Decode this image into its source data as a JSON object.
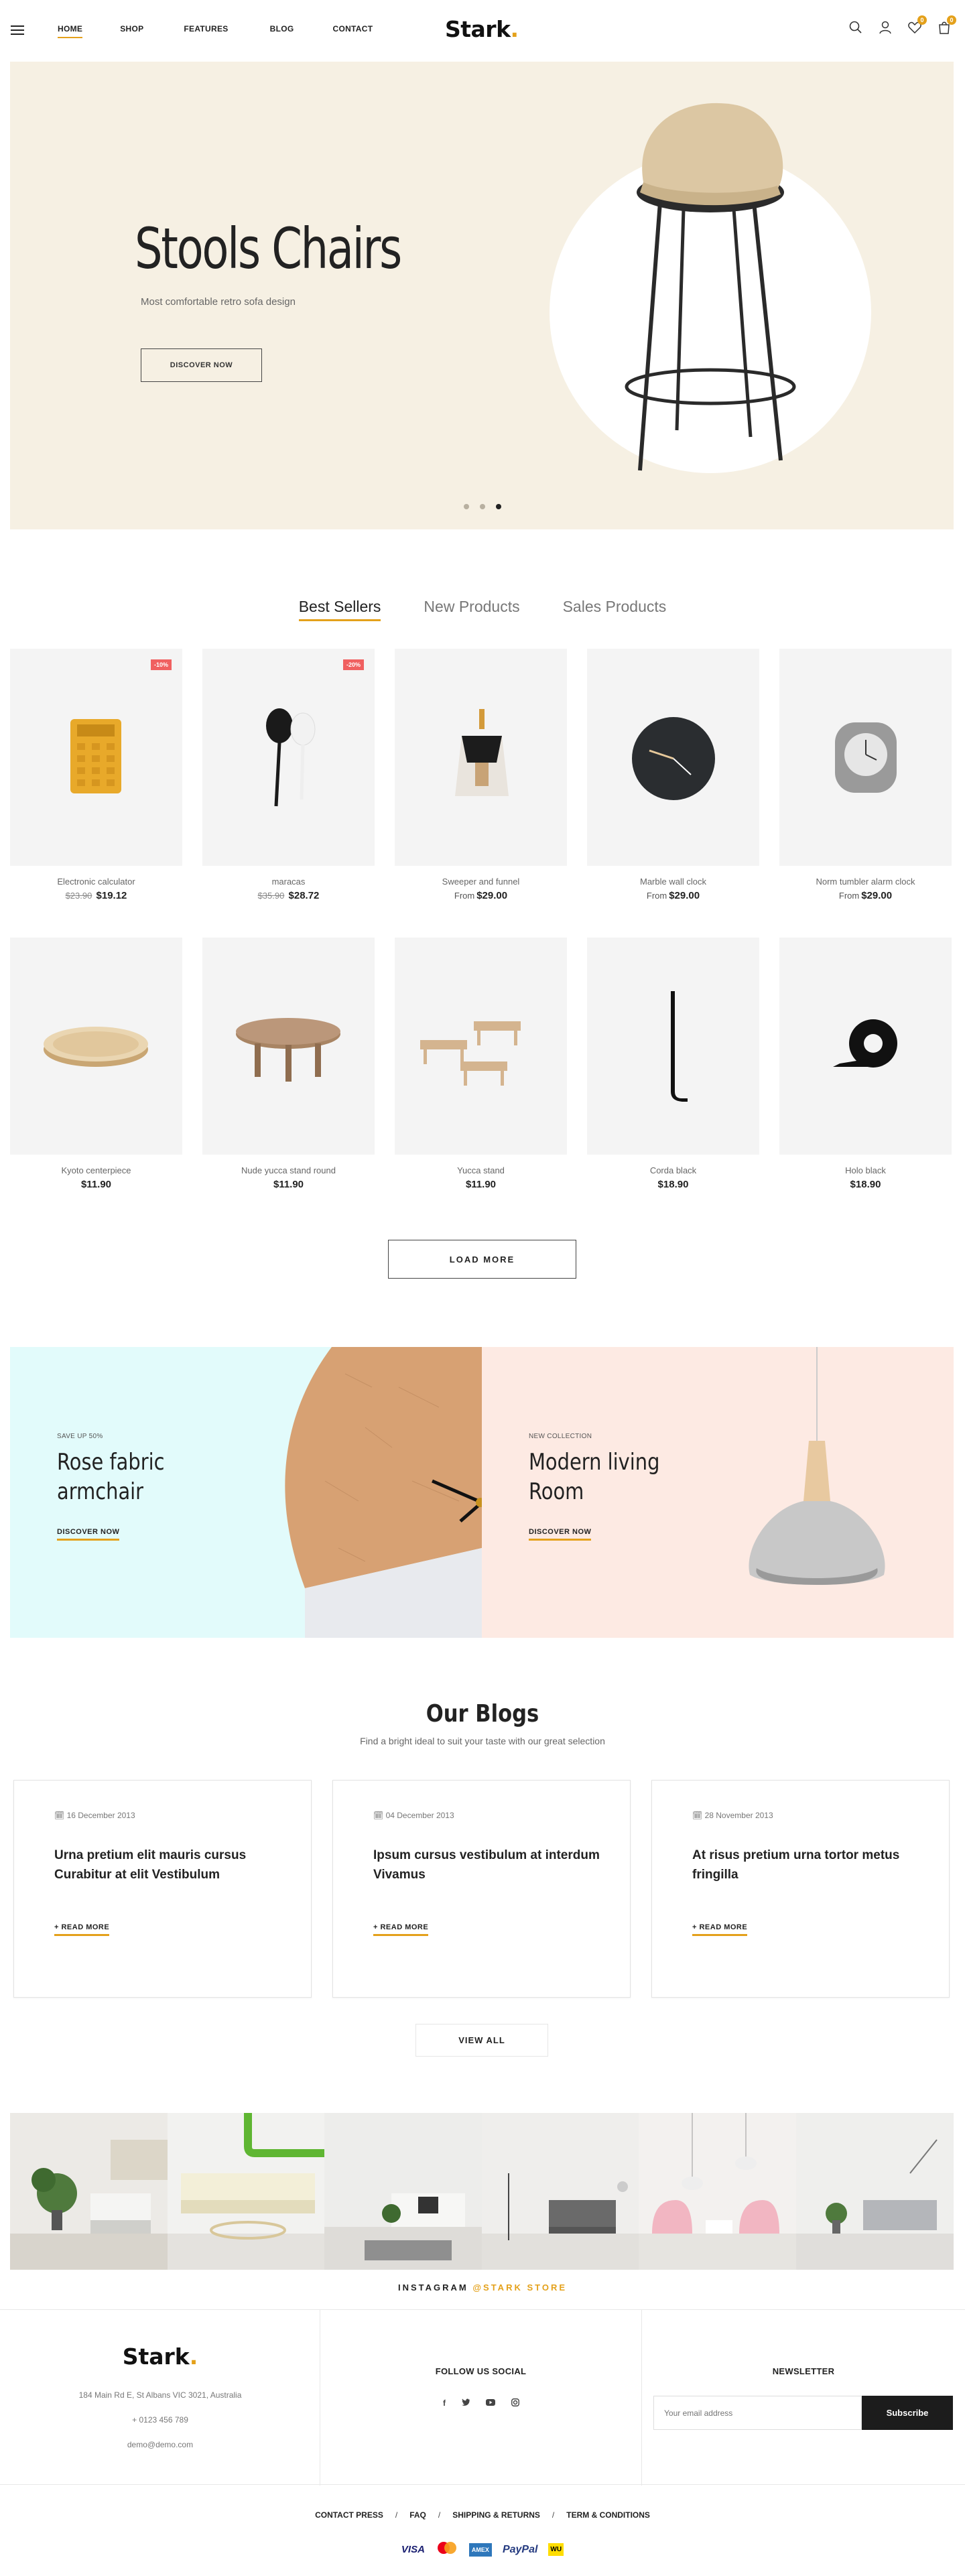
{
  "header": {
    "nav": [
      "HOME",
      "SHOP",
      "FEATURES",
      "BLOG",
      "CONTACT"
    ],
    "logo": "Stark",
    "logo_dot": ".",
    "wishlist_count": "0",
    "cart_count": "0",
    "icons": [
      "menu-icon",
      "search-icon",
      "user-icon",
      "heart-icon",
      "bag-icon"
    ]
  },
  "hero": {
    "title": "Stools Chairs",
    "subtitle": "Most comfortable retro sofa design",
    "button": "DISCOVER NOW",
    "slides": 3,
    "active_slide": 3
  },
  "tabs": [
    "Best Sellers",
    "New Products",
    "Sales Products"
  ],
  "products_row1": [
    {
      "name": "Electronic calculator",
      "old": "$23.90",
      "price": "$19.12",
      "sale": "-10%"
    },
    {
      "name": "maracas",
      "old": "$35.90",
      "price": "$28.72",
      "sale": "-20%"
    },
    {
      "name": "Sweeper and funnel",
      "from": "From",
      "price": "$29.00"
    },
    {
      "name": "Marble wall clock",
      "from": "From",
      "price": "$29.00"
    },
    {
      "name": "Norm tumbler alarm clock",
      "from": "From",
      "price": "$29.00"
    }
  ],
  "products_row2": [
    {
      "name": "Kyoto centerpiece",
      "price": "$11.90"
    },
    {
      "name": "Nude yucca stand round",
      "price": "$11.90"
    },
    {
      "name": "Yucca stand",
      "price": "$11.90"
    },
    {
      "name": "Corda black",
      "price": "$18.90"
    },
    {
      "name": "Holo black",
      "price": "$18.90"
    }
  ],
  "load_more": "LOAD MORE",
  "banners": {
    "left": {
      "kicker": "SAVE UP 50%",
      "title_line1": "Rose fabric",
      "title_line2": "armchair",
      "link": "DISCOVER NOW"
    },
    "right": {
      "kicker": "NEW COLLECTION",
      "title_line1": "Modern living",
      "title_line2": "Room",
      "link": "DISCOVER NOW"
    }
  },
  "blogs": {
    "title": "Our Blogs",
    "subtitle": "Find a bright ideal to suit your taste with our great selection",
    "posts": [
      {
        "date": "16 December 2013",
        "title": "Urna pretium elit mauris cursus Curabitur at elit Vestibulum",
        "link": "+ READ MORE"
      },
      {
        "date": "04 December 2013",
        "title": "Ipsum cursus vestibulum at interdum Vivamus",
        "link": "+ READ MORE"
      },
      {
        "date": "28 November 2013",
        "title": "At risus pretium urna tortor metus fringilla",
        "link": "+ READ MORE"
      }
    ],
    "view_all": "VIEW ALL"
  },
  "instagram": {
    "label": "INSTAGRAM",
    "account": "@STARK STORE"
  },
  "footer": {
    "logo": "Stark",
    "address": "184 Main Rd E, St Albans VIC 3021, Australia",
    "phone": "+ 0123 456 789",
    "email": "demo@demo.com",
    "social_title": "FOLLOW US SOCIAL",
    "social": [
      "f",
      "t",
      "yt",
      "ig"
    ],
    "newsletter_title": "NEWSLETTER",
    "newsletter_placeholder": "Your email address",
    "subscribe": "Subscribe",
    "links": [
      "CONTACT PRESS",
      "FAQ",
      "SHIPPING & RETURNS",
      "TERM & CONDITIONS"
    ],
    "payments": [
      "VISA",
      "mastercard",
      "AMEX",
      "PayPal",
      "WU"
    ]
  },
  "colors": {
    "accent": "#e4a11b",
    "hero_bg": "#f6f0e3",
    "banner_left_bg": "#e2fbfb",
    "banner_right_bg": "#fdeae3",
    "sale": "#f06060"
  }
}
